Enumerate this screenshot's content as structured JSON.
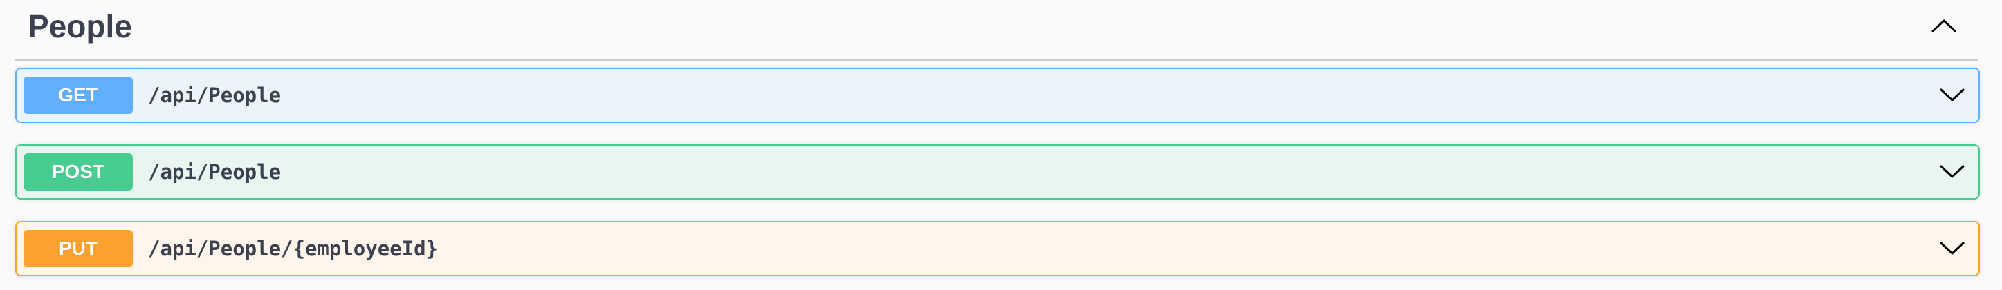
{
  "section": {
    "title": "People",
    "toggle_icon": "chevron-up-icon"
  },
  "operations": [
    {
      "method": "GET",
      "path": "/api/People",
      "color": "#61affe",
      "expand_icon": "chevron-down-icon"
    },
    {
      "method": "POST",
      "path": "/api/People",
      "color": "#49cc90",
      "expand_icon": "chevron-down-icon"
    },
    {
      "method": "PUT",
      "path": "/api/People/{employeeId}",
      "color": "#fca130",
      "expand_icon": "chevron-down-icon"
    }
  ]
}
